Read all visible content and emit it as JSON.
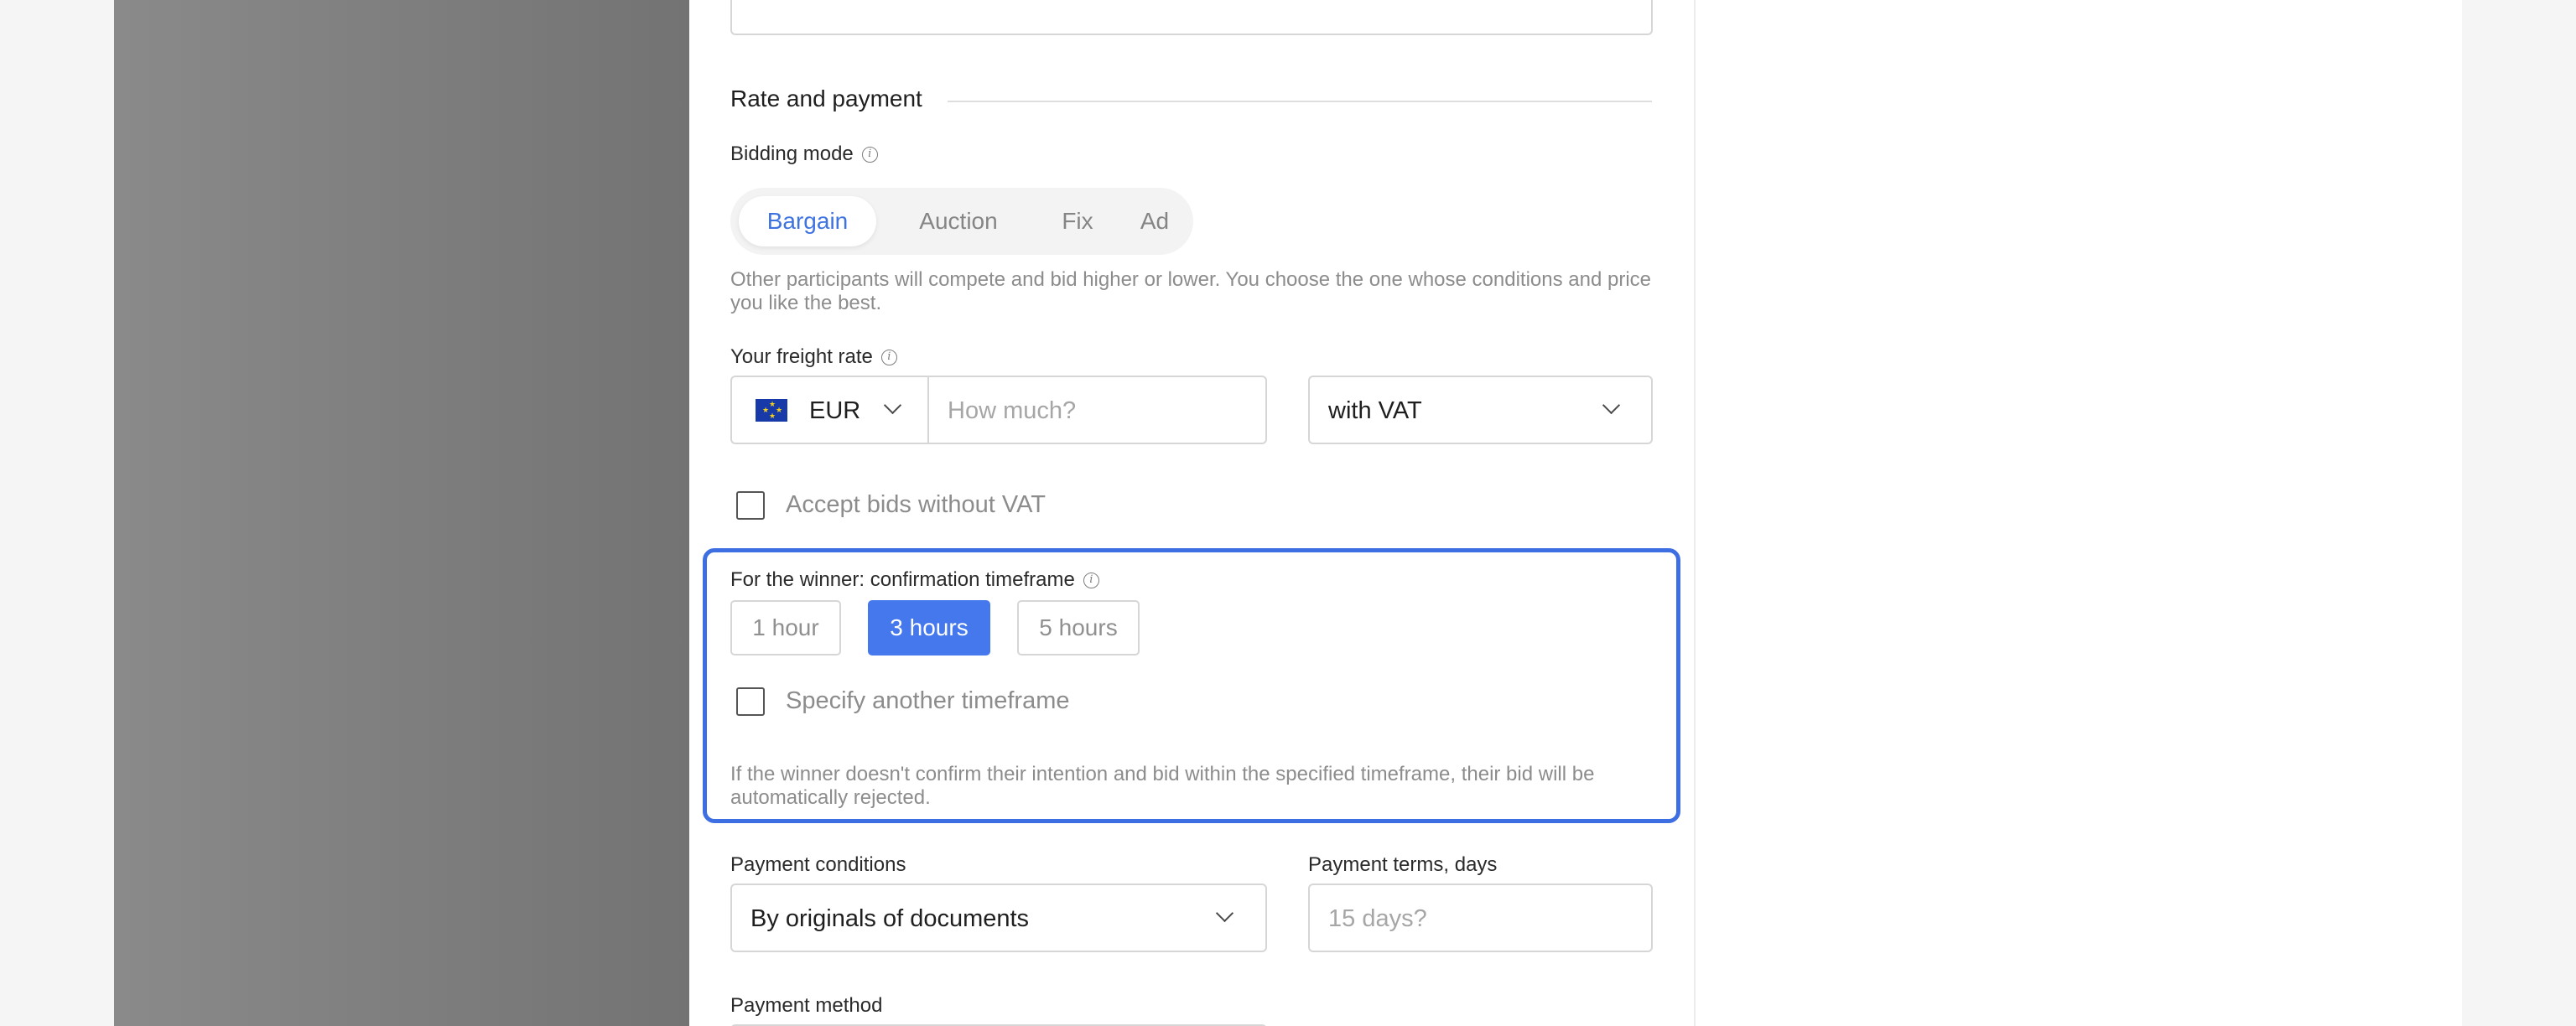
{
  "section": {
    "title": "Rate and payment"
  },
  "bidding_mode": {
    "label": "Bidding mode",
    "options": [
      "Bargain",
      "Auction",
      "Fix",
      "Ad"
    ],
    "selected": "Bargain",
    "hint": "Other participants will compete and bid higher or lower. You choose the one whose conditions and price you like the best."
  },
  "freight_rate": {
    "label": "Your freight rate",
    "currency": "EUR",
    "amount_placeholder": "How much?",
    "vat_option": "with VAT"
  },
  "accept_bids": {
    "label": "Accept bids without VAT",
    "checked": false
  },
  "confirmation": {
    "label": "For the winner: confirmation timeframe",
    "options": [
      "1 hour",
      "3 hours",
      "5 hours"
    ],
    "selected": "3 hours",
    "specify_label": "Specify another timeframe",
    "hint": "If the winner doesn't confirm their intention and bid within the specified timeframe, their bid will be automatically rejected."
  },
  "payment": {
    "conditions_label": "Payment conditions",
    "conditions_value": "By originals of documents",
    "terms_label": "Payment terms, days",
    "terms_placeholder": "15 days?",
    "method_label": "Payment method"
  },
  "colors": {
    "accent": "#3e6fe2",
    "active_button": "#4578ec",
    "eu_flag": "#183aa8"
  },
  "icons": [
    "info-icon",
    "chevron-down-icon",
    "eu-flag-icon",
    "checkbox-icon"
  ]
}
